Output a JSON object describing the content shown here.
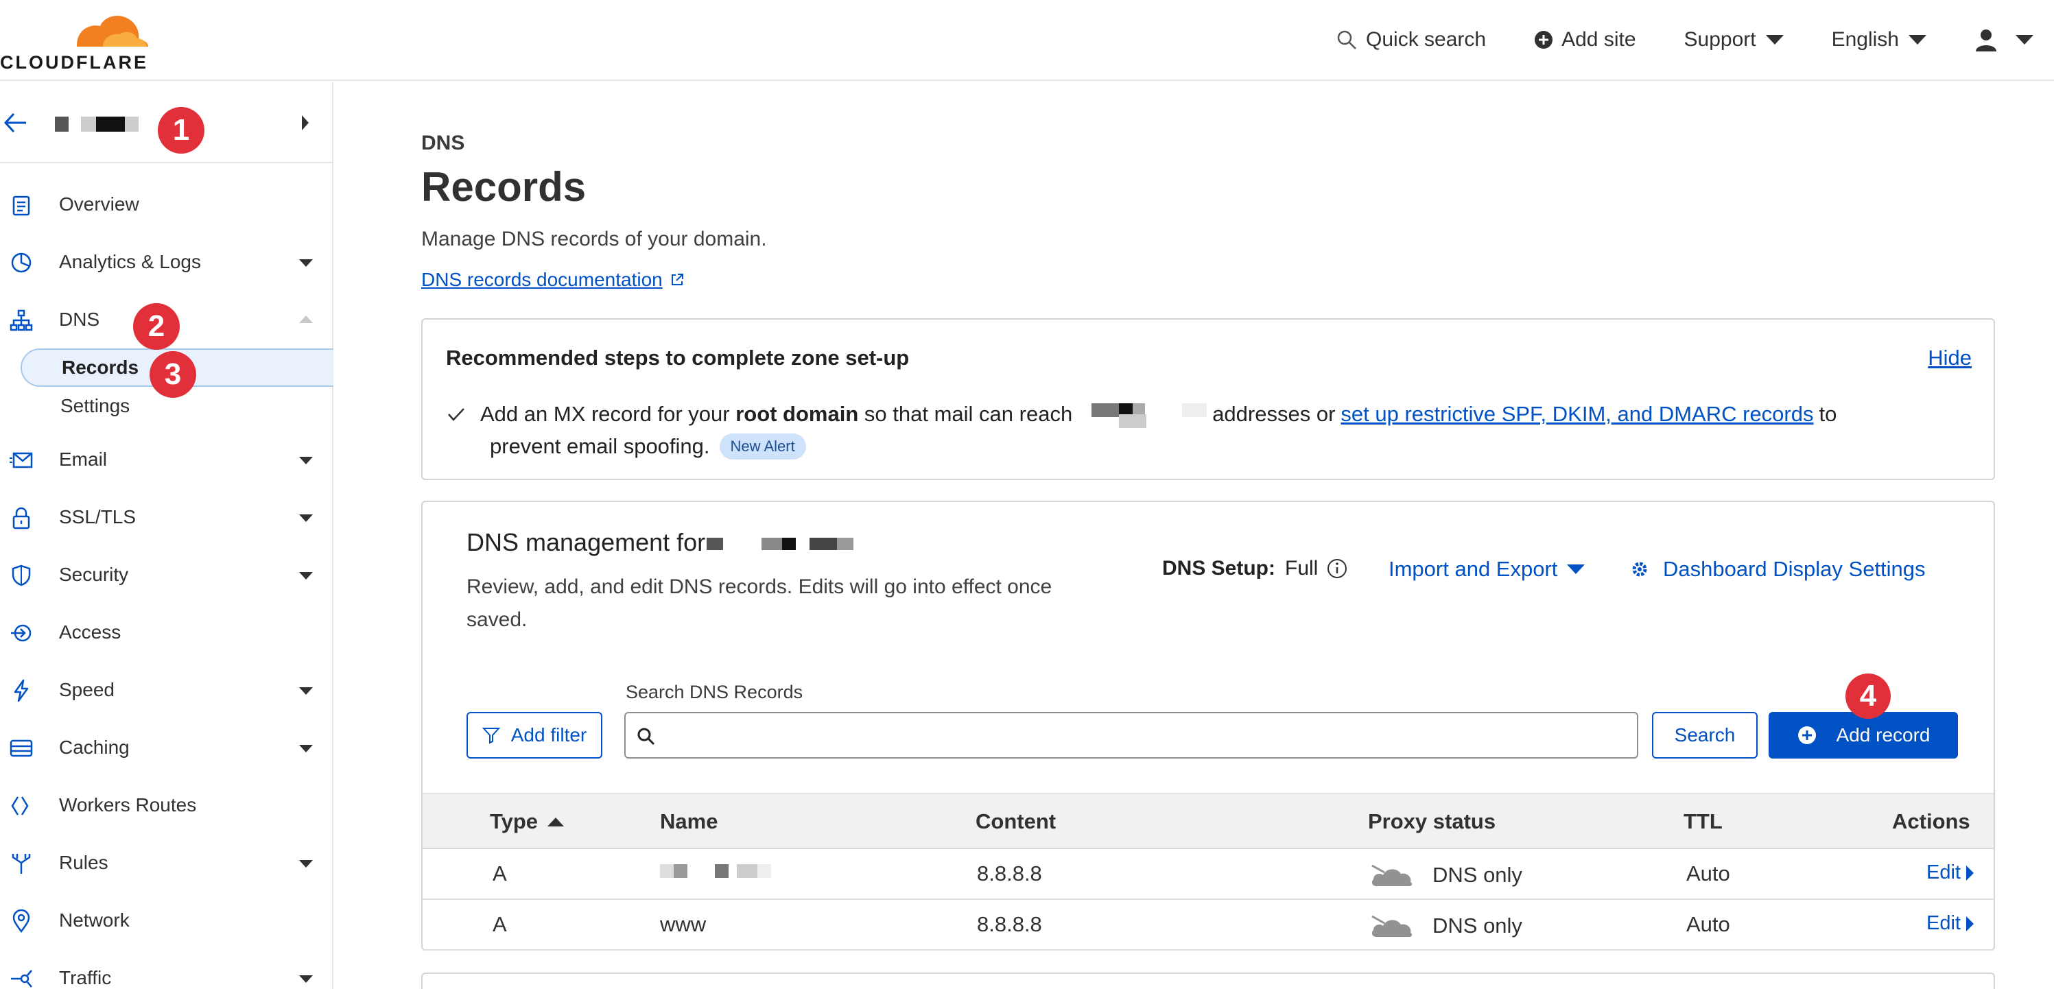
{
  "topbar": {
    "logo_text": "CLOUDFLARE",
    "quick_search": "Quick search",
    "add_site": "Add site",
    "support": "Support",
    "language": "English"
  },
  "sidebar": {
    "zone_badge": "1",
    "items": [
      {
        "label": "Overview"
      },
      {
        "label": "Analytics & Logs"
      },
      {
        "label": "DNS"
      },
      {
        "label": "Records"
      },
      {
        "label": "Settings"
      },
      {
        "label": "Email"
      },
      {
        "label": "SSL/TLS"
      },
      {
        "label": "Security"
      },
      {
        "label": "Access"
      },
      {
        "label": "Speed"
      },
      {
        "label": "Caching"
      },
      {
        "label": "Workers Routes"
      },
      {
        "label": "Rules"
      },
      {
        "label": "Network"
      },
      {
        "label": "Traffic"
      }
    ],
    "badge_dns": "2",
    "badge_records": "3"
  },
  "page": {
    "breadcrumb": "DNS",
    "title": "Records",
    "subtitle": "Manage DNS records of your domain.",
    "doc_link": "DNS records documentation"
  },
  "recommended": {
    "title": "Recommended steps to complete zone set-up",
    "hide": "Hide",
    "text_1": "Add an MX record for your",
    "text_bold": "root domain",
    "text_2": "so that mail can reach",
    "text_3": "addresses or",
    "link": "set up restrictive SPF, DKIM, and DMARC records",
    "text_4": "to",
    "text_5": "prevent email spoofing.",
    "alert_badge": "New Alert"
  },
  "dns_management": {
    "heading": "DNS management for",
    "description": "Review, add, and edit DNS records. Edits will go into effect once saved.",
    "setup_label": "DNS Setup:",
    "setup_value": "Full",
    "import_export": "Import and Export",
    "display_settings": "Dashboard Display Settings",
    "search_label": "Search DNS Records",
    "search_placeholder": "",
    "add_filter": "Add filter",
    "search_button": "Search",
    "add_record": "Add record",
    "add_record_badge": "4"
  },
  "table": {
    "columns": [
      "Type",
      "Name",
      "Content",
      "Proxy status",
      "TTL",
      "Actions"
    ],
    "rows": [
      {
        "type": "A",
        "name": "",
        "content": "8.8.8.8",
        "proxy": "DNS only",
        "ttl": "Auto",
        "action": "Edit"
      },
      {
        "type": "A",
        "name": "www",
        "content": "8.8.8.8",
        "proxy": "DNS only",
        "ttl": "Auto",
        "action": "Edit"
      }
    ]
  },
  "colors": {
    "accent": "#0051c3",
    "badge_red": "#e2303a",
    "logo_orange": "#f38020"
  }
}
